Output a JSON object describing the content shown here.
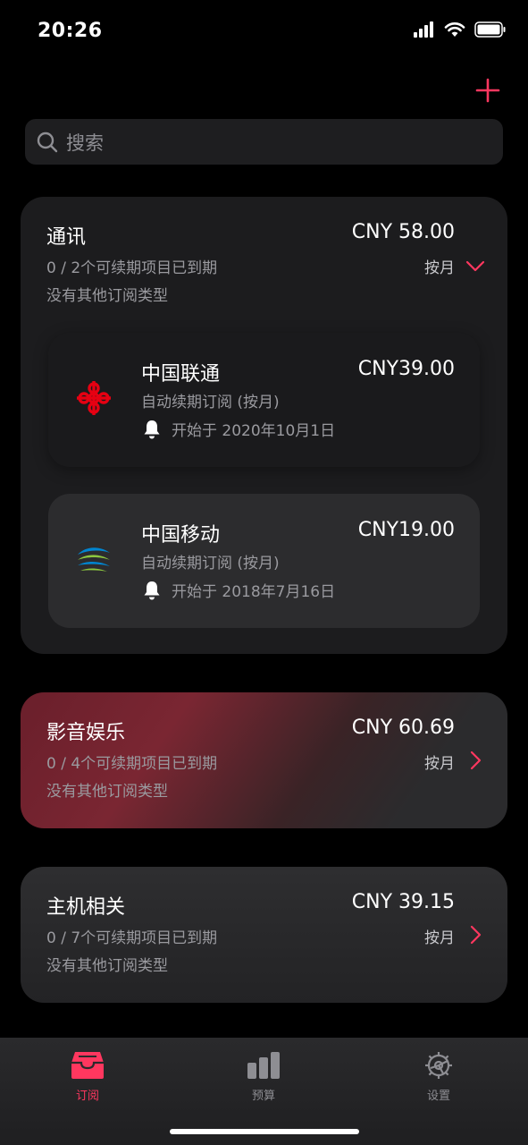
{
  "status_bar": {
    "time": "20:26"
  },
  "search": {
    "placeholder": "搜索"
  },
  "colors": {
    "accent": "#ff375f",
    "bg": "#000000",
    "card": "#1c1c1e"
  },
  "groups": [
    {
      "title": "通讯",
      "amount": "CNY 58.00",
      "expired": "0 / 2个可续期项目已到期",
      "other": "没有其他订阅类型",
      "cycle": "按月",
      "expanded": true,
      "items": [
        {
          "name": "中国联通",
          "price": "CNY39.00",
          "type": "自动续期订阅 (按月)",
          "start": "开始于 2020年10月1日",
          "icon": "china-unicom-logo"
        },
        {
          "name": "中国移动",
          "price": "CNY19.00",
          "type": "自动续期订阅 (按月)",
          "start": "开始于 2018年7月16日",
          "icon": "china-mobile-logo"
        }
      ]
    },
    {
      "title": "影音娱乐",
      "amount": "CNY 60.69",
      "expired": "0 / 4个可续期项目已到期",
      "other": "没有其他订阅类型",
      "cycle": "按月",
      "expanded": false
    },
    {
      "title": "主机相关",
      "amount": "CNY 39.15",
      "expired": "0 / 7个可续期项目已到期",
      "other": "没有其他订阅类型",
      "cycle": "按月",
      "expanded": false
    }
  ],
  "tabs": [
    {
      "label": "订阅",
      "icon": "inbox-icon",
      "active": true
    },
    {
      "label": "预算",
      "icon": "bar-chart-icon",
      "active": false
    },
    {
      "label": "设置",
      "icon": "gear-icon",
      "active": false
    }
  ]
}
